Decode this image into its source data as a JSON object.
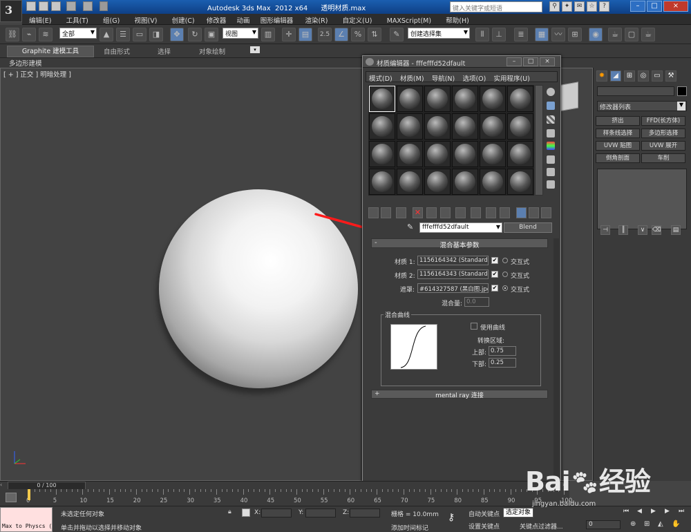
{
  "titlebar": {
    "title": "Autodesk 3ds Max  2012 x64      透明材质.max",
    "search_placeholder": "键入关键字或短语",
    "window_buttons": [
      "–",
      "□",
      "×"
    ]
  },
  "menu": [
    "编辑(E)",
    "工具(T)",
    "组(G)",
    "视图(V)",
    "创建(C)",
    "修改器",
    "动画",
    "图形编辑器",
    "渲染(R)",
    "自定义(U)",
    "MAXScript(M)",
    "帮助(H)"
  ],
  "toolbar": {
    "selection_filter": "全部",
    "ref_coord": "视图",
    "named_selection": "创建选择集",
    "snap_angle": "2.5"
  },
  "ribbon": {
    "tabs": [
      "Graphite 建模工具",
      "自由形式",
      "选择",
      "对象绘制"
    ],
    "sub": "多边形建模"
  },
  "viewport": {
    "label": "[ + ] 正交 ] 明暗处理 ]"
  },
  "material_editor": {
    "title": "材质编辑器 - fffefffd52dfault",
    "menu": [
      "模式(D)",
      "材质(M)",
      "导航(N)",
      "选项(O)",
      "实用程序(U)"
    ],
    "material_name": "fffefffd52dfault",
    "material_type": "Blend",
    "rollout_title": "混合基本参数",
    "material1_label": "材质 1:",
    "material1_value": "1156164342 (Standard)",
    "material2_label": "材质 2:",
    "material2_value": "1156164343 (Standard)",
    "mask_label": "遮罩:",
    "mask_value": "#614327587 (黑白图.jpg)",
    "interactive": "交互式",
    "mix_amount_label": "混合量:",
    "mix_amount": "0.0",
    "curve_group": "混合曲线",
    "use_curve": "使用曲线",
    "transition_zone": "转换区域:",
    "upper_label": "上部:",
    "upper": "0.75",
    "lower_label": "下部:",
    "lower": "0.25",
    "mr_rollout": "mental ray 连接",
    "rollout_toggle_open": "-",
    "rollout_toggle_closed": "+"
  },
  "command_panel": {
    "modifier_list": "修改器列表",
    "buttons": [
      "挤出",
      "FFD(长方体)",
      "样条线选择",
      "多边形选择",
      "UVW 贴图",
      "UVW 展开",
      "倒角剖面",
      "车削"
    ]
  },
  "timeline": {
    "frame": "0 / 100",
    "ticks": [
      "0",
      "5",
      "10",
      "15",
      "20",
      "25",
      "30",
      "35",
      "40",
      "45",
      "50",
      "55",
      "60",
      "65",
      "70",
      "75",
      "80",
      "85",
      "90",
      "95",
      "100"
    ]
  },
  "status": {
    "maxscript": "Max to Physcs (",
    "selection": "未选定任何对象",
    "prompt": "单击并拖动以选择并移动对象",
    "x_label": "X:",
    "y_label": "Y:",
    "z_label": "Z:",
    "grid": "栅格 = 10.0mm",
    "add_time_tag": "添加时间标记",
    "auto_key": "自动关键点",
    "set_key": "设置关键点",
    "selected": "选定对象",
    "key_filters": "关键点过滤器...",
    "frame_value": "0"
  },
  "watermark": {
    "brand": "Bai",
    "brand2": "经验",
    "url": "jingyan.baidu.com"
  },
  "colors": {
    "annotation": "#ff1a1a",
    "title_bar": "#1b5fb0"
  }
}
